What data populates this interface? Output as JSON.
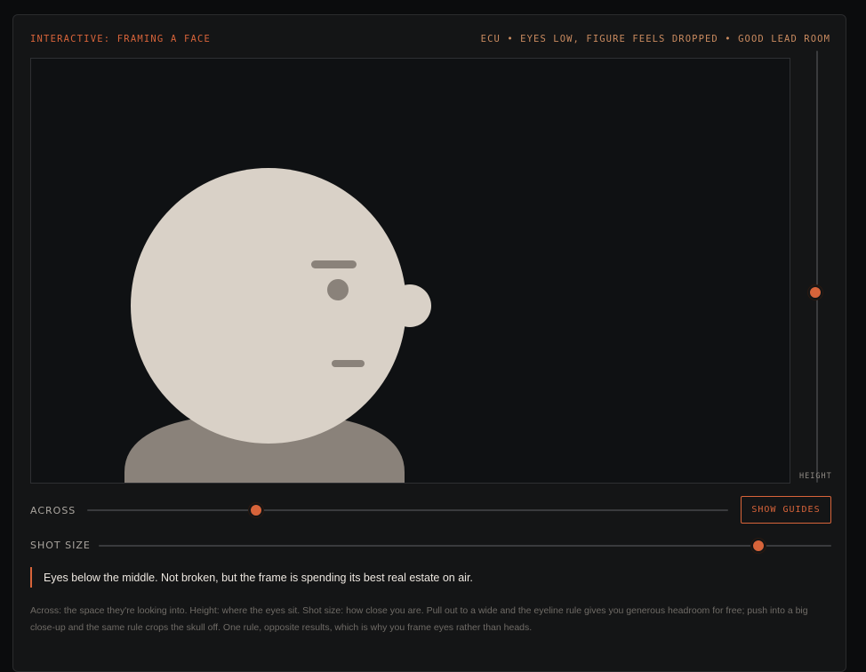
{
  "header": {
    "title": "INTERACTIVE: FRAMING A FACE",
    "status": "ECU • EYES LOW, FIGURE FEELS DROPPED • GOOD LEAD ROOM"
  },
  "sliders": {
    "height": {
      "label": "HEIGHT",
      "value": 0.56
    },
    "across": {
      "label": "ACROSS",
      "value": 0.265
    },
    "shot_size": {
      "label": "SHOT SIZE",
      "value": 0.89
    }
  },
  "buttons": {
    "show_guides": "SHOW GUIDES"
  },
  "colors": {
    "accent": "#d8643a",
    "face": "#d9d1c7",
    "features": "#8a827a",
    "shoulders": "#8a827a",
    "frame_bg": "#0f1113"
  },
  "callout": "Eyes below the middle. Not broken, but the frame is spending its best real estate on air.",
  "description": "Across: the space they're looking into. Height: where the eyes sit. Shot size: how close you are. Pull out to a wide and the eyeline rule gives you generous headroom for free; push into a big close-up and the same rule crops the skull off. One rule, opposite results, which is why you frame eyes rather than heads."
}
